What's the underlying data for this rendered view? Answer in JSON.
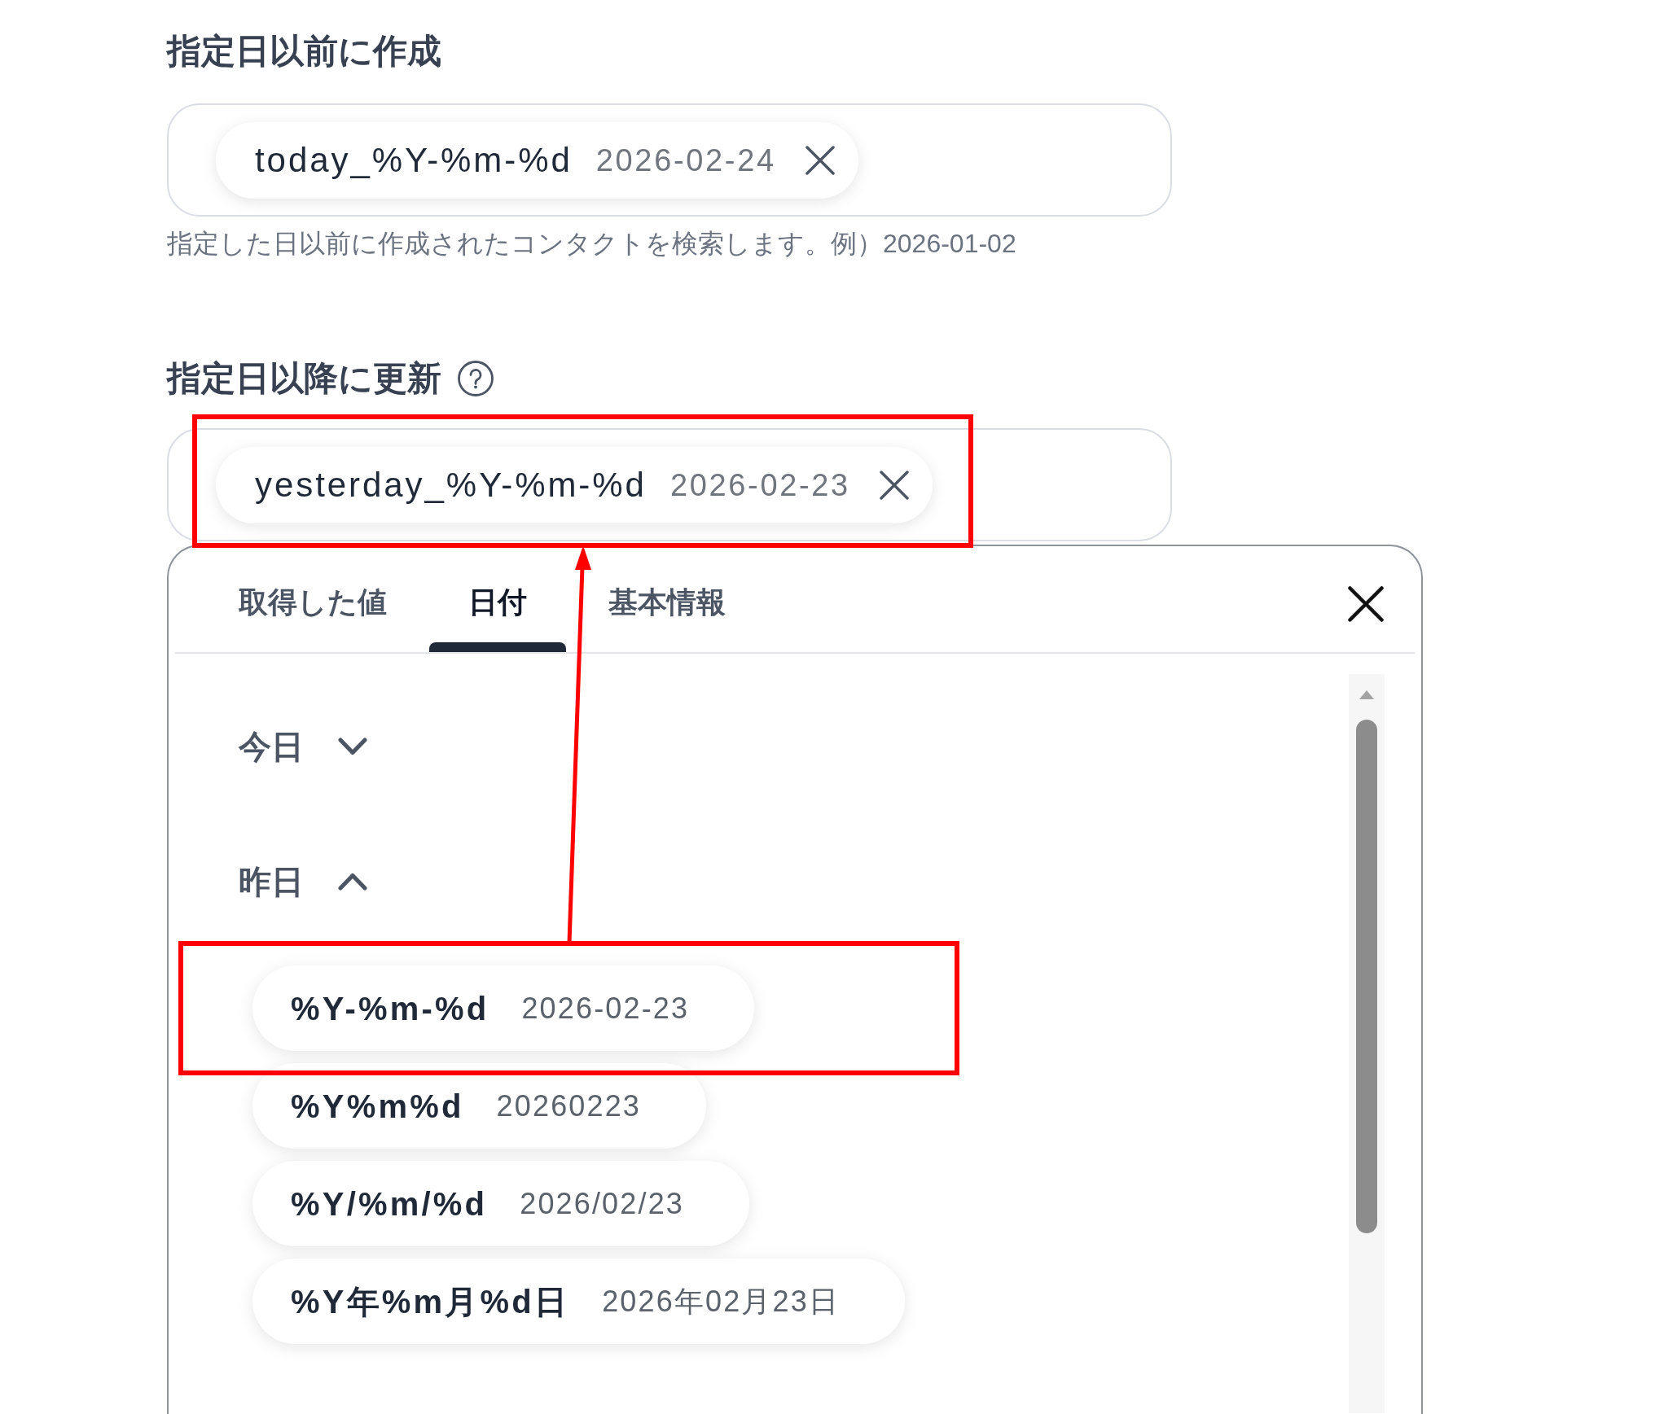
{
  "fields": [
    {
      "label": "指定日以前に作成",
      "help_icon": false,
      "chip": {
        "name": "today_%Y-%m-%d",
        "value": "2026-02-24",
        "highlighted": false
      },
      "hint": "指定した日以前に作成されたコンタクトを検索します。例）2026-01-02"
    },
    {
      "label": "指定日以降に更新",
      "help_icon": true,
      "chip": {
        "name": "yesterday_%Y-%m-%d",
        "value": "2026-02-23",
        "highlighted": true
      }
    }
  ],
  "picker": {
    "tabs": [
      {
        "label": "取得した値",
        "selected": false
      },
      {
        "label": "日付",
        "selected": true
      },
      {
        "label": "基本情報",
        "selected": false
      }
    ],
    "groups": [
      {
        "label": "今日",
        "expanded": false
      },
      {
        "label": "昨日",
        "expanded": true,
        "items": [
          {
            "name": "%Y-%m-%d",
            "value": "2026-02-23",
            "highlighted": true
          },
          {
            "name": "%Y%m%d",
            "value": "20260223",
            "highlighted": false
          },
          {
            "name": "%Y/%m/%d",
            "value": "2026/02/23",
            "highlighted": false
          },
          {
            "name": "%Y年%m月%d日",
            "value": "2026年02月23日",
            "highlighted": false
          }
        ]
      }
    ]
  },
  "annotation_arrow": true
}
